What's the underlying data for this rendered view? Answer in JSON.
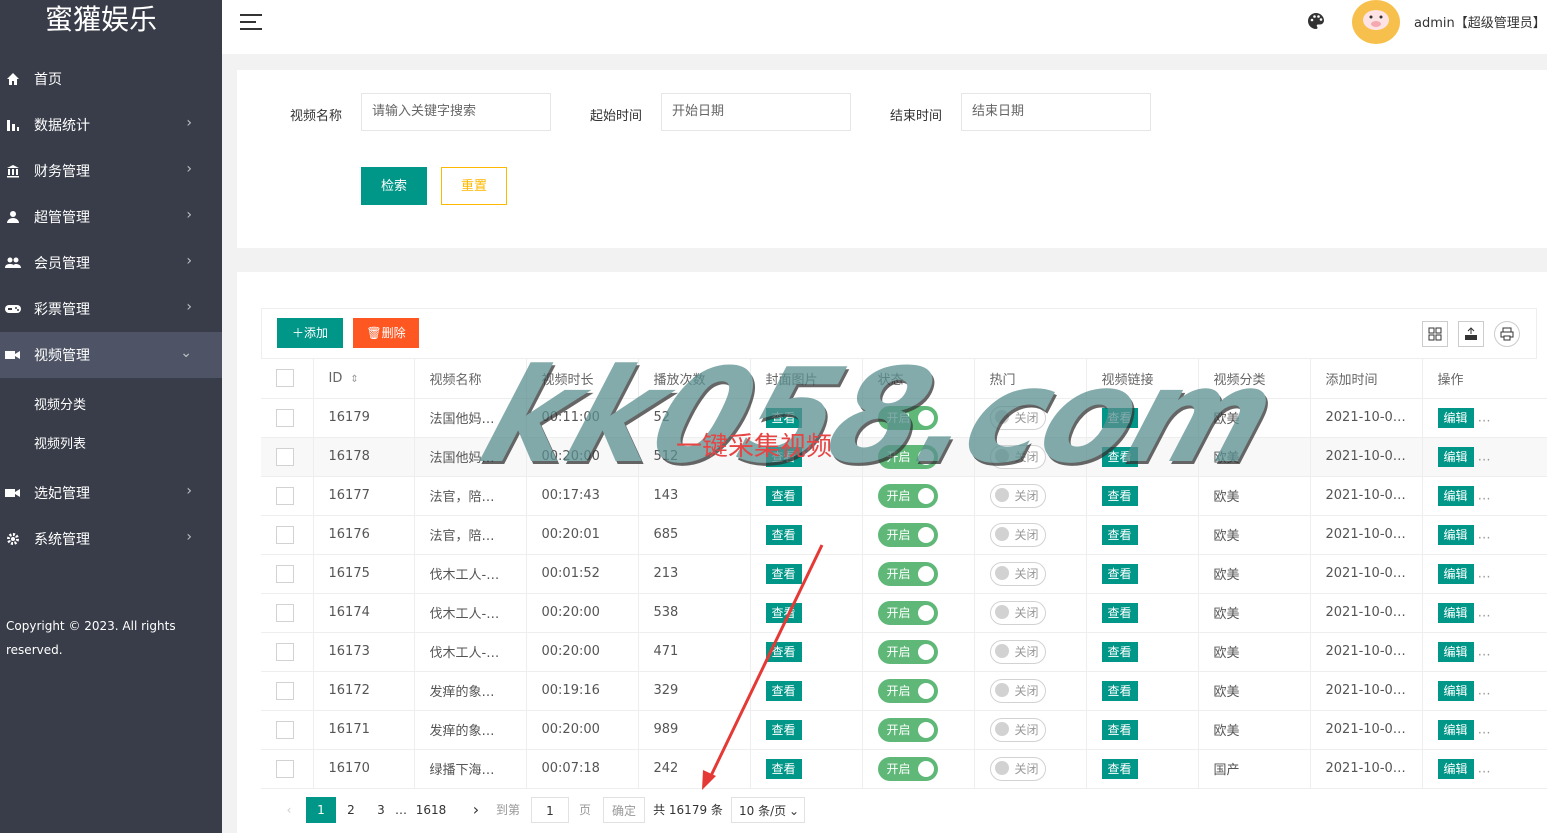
{
  "app": {
    "logo": "蜜獾娱乐"
  },
  "sidebar": {
    "items": [
      {
        "label": "首页",
        "icon": "home-icon",
        "has_arrow": false
      },
      {
        "label": "数据统计",
        "icon": "bar-chart-icon",
        "has_arrow": true
      },
      {
        "label": "财务管理",
        "icon": "bank-icon",
        "has_arrow": true
      },
      {
        "label": "超管管理",
        "icon": "user-icon",
        "has_arrow": true
      },
      {
        "label": "会员管理",
        "icon": "users-icon",
        "has_arrow": true
      },
      {
        "label": "彩票管理",
        "icon": "gamepad-icon",
        "has_arrow": true
      },
      {
        "label": "视频管理",
        "icon": "video-icon",
        "has_arrow": true,
        "active": true
      }
    ],
    "subitems": [
      {
        "label": "视频分类"
      },
      {
        "label": "视频列表"
      }
    ],
    "items_after": [
      {
        "label": "选妃管理",
        "icon": "video-icon",
        "has_arrow": true
      },
      {
        "label": "系统管理",
        "icon": "gear-icon",
        "has_arrow": true
      }
    ],
    "copyright": "Copyright © 2023. All rights reserved."
  },
  "header": {
    "user": "admin【超级管理员】"
  },
  "search": {
    "name_label": "视频名称",
    "name_placeholder": "请输入关键字搜索",
    "start_label": "起始时间",
    "start_placeholder": "开始日期",
    "end_label": "结束时间",
    "end_placeholder": "结束日期",
    "search_btn": "检索",
    "reset_btn": "重置"
  },
  "toolbar": {
    "add": "添加",
    "delete": "删除"
  },
  "table": {
    "headers": [
      "ID",
      "视频名称",
      "视频时长",
      "播放次数",
      "封面图片",
      "状态",
      "热门",
      "视频链接",
      "视频分类",
      "添加时间",
      "操作"
    ],
    "view_label": "查看",
    "edit_label": "编辑",
    "on_label": "开启",
    "off_label": "关闭",
    "rows": [
      {
        "id": "16179",
        "name": "法国他妈…",
        "duration": "00:11:00",
        "plays": "52",
        "category": "欧美",
        "time": "2021-10-0…"
      },
      {
        "id": "16178",
        "name": "法国他妈…",
        "duration": "00:20:00",
        "plays": "512",
        "category": "欧美",
        "time": "2021-10-0…"
      },
      {
        "id": "16177",
        "name": "法官，陪…",
        "duration": "00:17:43",
        "plays": "143",
        "category": "欧美",
        "time": "2021-10-0…"
      },
      {
        "id": "16176",
        "name": "法官，陪…",
        "duration": "00:20:01",
        "plays": "685",
        "category": "欧美",
        "time": "2021-10-0…"
      },
      {
        "id": "16175",
        "name": "伐木工人-…",
        "duration": "00:01:52",
        "plays": "213",
        "category": "欧美",
        "time": "2021-10-0…"
      },
      {
        "id": "16174",
        "name": "伐木工人-…",
        "duration": "00:20:00",
        "plays": "538",
        "category": "欧美",
        "time": "2021-10-0…"
      },
      {
        "id": "16173",
        "name": "伐木工人-…",
        "duration": "00:20:00",
        "plays": "471",
        "category": "欧美",
        "time": "2021-10-0…"
      },
      {
        "id": "16172",
        "name": "发痒的象…",
        "duration": "00:19:16",
        "plays": "329",
        "category": "欧美",
        "time": "2021-10-0…"
      },
      {
        "id": "16171",
        "name": "发痒的象…",
        "duration": "00:20:00",
        "plays": "989",
        "category": "欧美",
        "time": "2021-10-0…"
      },
      {
        "id": "16170",
        "name": "绿播下海…",
        "duration": "00:07:18",
        "plays": "242",
        "category": "国产",
        "time": "2021-10-0…"
      }
    ]
  },
  "pagination": {
    "current": "1",
    "p2": "2",
    "p3": "3",
    "ellipsis": "…",
    "last": "1618",
    "goto": "到第",
    "goto_value": "1",
    "page_unit": "页",
    "confirm": "确定",
    "total": "共 16179 条",
    "page_size": "10 条/页"
  },
  "watermark": {
    "text": "kk058.com",
    "caption": "一键采集视频"
  },
  "colors": {
    "sidebar": "#393d49",
    "primary": "#009688",
    "warm": "#ffb800",
    "danger": "#ff5722",
    "switch_on": "#5fb878"
  }
}
